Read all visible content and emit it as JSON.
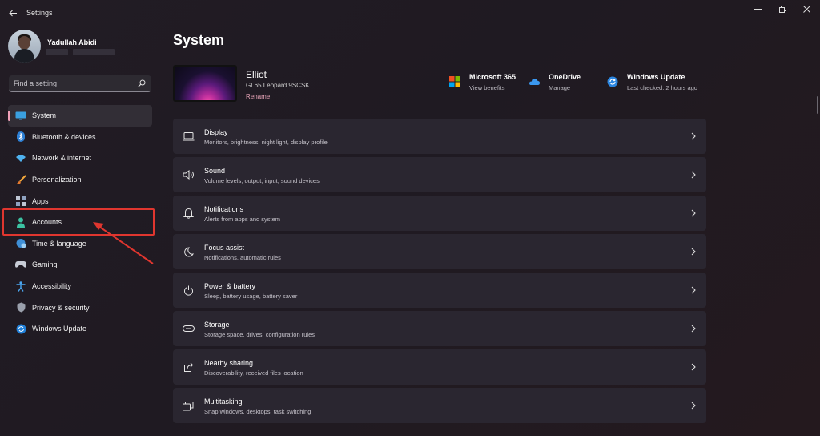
{
  "window": {
    "title": "Settings",
    "back_icon": "back-arrow-icon",
    "controls": [
      "minimize-icon",
      "restore-icon",
      "close-icon"
    ]
  },
  "profile": {
    "name": "Yadullah Abidi"
  },
  "search": {
    "placeholder": "Find a setting",
    "icon": "search-icon"
  },
  "sidebar": {
    "items": [
      {
        "label": "System",
        "icon": "system-display-icon",
        "selected": true
      },
      {
        "label": "Bluetooth & devices",
        "icon": "bluetooth-icon"
      },
      {
        "label": "Network & internet",
        "icon": "wifi-icon"
      },
      {
        "label": "Personalization",
        "icon": "brush-icon"
      },
      {
        "label": "Apps",
        "icon": "apps-grid-icon"
      },
      {
        "label": "Accounts",
        "icon": "person-icon",
        "highlighted": true
      },
      {
        "label": "Time & language",
        "icon": "globe-clock-icon"
      },
      {
        "label": "Gaming",
        "icon": "game-controller-icon"
      },
      {
        "label": "Accessibility",
        "icon": "accessibility-icon"
      },
      {
        "label": "Privacy & security",
        "icon": "shield-icon"
      },
      {
        "label": "Windows Update",
        "icon": "update-icon"
      }
    ]
  },
  "main": {
    "title": "System",
    "device": {
      "name": "Elliot",
      "model": "GL65 Leopard 9SCSK",
      "rename": "Rename"
    },
    "quick_links": [
      {
        "title": "Microsoft 365",
        "subtitle": "View benefits",
        "icon": "microsoft-logo-icon"
      },
      {
        "title": "OneDrive",
        "subtitle": "Manage",
        "icon": "cloud-icon"
      },
      {
        "title": "Windows Update",
        "subtitle": "Last checked: 2 hours ago",
        "icon": "sync-icon"
      }
    ],
    "cards": [
      {
        "title": "Display",
        "subtitle": "Monitors, brightness, night light, display profile",
        "icon": "laptop-icon"
      },
      {
        "title": "Sound",
        "subtitle": "Volume levels, output, input, sound devices",
        "icon": "speaker-icon"
      },
      {
        "title": "Notifications",
        "subtitle": "Alerts from apps and system",
        "icon": "bell-icon"
      },
      {
        "title": "Focus assist",
        "subtitle": "Notifications, automatic rules",
        "icon": "moon-icon"
      },
      {
        "title": "Power & battery",
        "subtitle": "Sleep, battery usage, battery saver",
        "icon": "power-icon"
      },
      {
        "title": "Storage",
        "subtitle": "Storage space, drives, configuration rules",
        "icon": "storage-drive-icon"
      },
      {
        "title": "Nearby sharing",
        "subtitle": "Discoverability, received files location",
        "icon": "share-icon"
      },
      {
        "title": "Multitasking",
        "subtitle": "Snap windows, desktops, task switching",
        "icon": "multitask-windows-icon"
      }
    ]
  },
  "colors": {
    "accent": "#f0a0b8",
    "annotation": "#e0362f"
  }
}
